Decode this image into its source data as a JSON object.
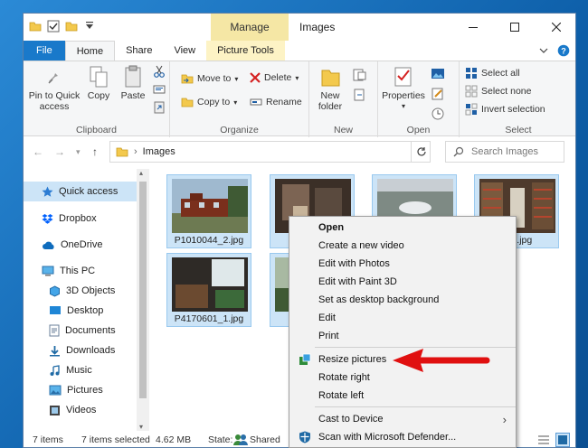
{
  "window": {
    "title": "Images",
    "context_tab": "Manage",
    "context_tab_group": "Picture Tools"
  },
  "ribbon": {
    "tabs": [
      "File",
      "Home",
      "Share",
      "View",
      "Picture Tools"
    ],
    "clipboard": {
      "pin": "Pin to Quick access",
      "copy": "Copy",
      "paste": "Paste",
      "label": "Clipboard"
    },
    "organize": {
      "move_to": "Move to",
      "copy_to": "Copy to",
      "delete": "Delete",
      "rename": "Rename",
      "label": "Organize"
    },
    "new": {
      "new_folder": "New folder",
      "label": "New"
    },
    "open": {
      "properties": "Properties",
      "label": "Open"
    },
    "select": {
      "select_all": "Select all",
      "select_none": "Select none",
      "invert": "Invert selection",
      "label": "Select"
    }
  },
  "address": {
    "path": "Images",
    "search_placeholder": "Search Images"
  },
  "navpane": {
    "items": [
      {
        "label": "Quick access",
        "icon": "star-icon"
      },
      {
        "label": "Dropbox",
        "icon": "dropbox-icon"
      },
      {
        "label": "OneDrive",
        "icon": "cloud-icon"
      },
      {
        "label": "This PC",
        "icon": "computer-icon"
      },
      {
        "label": "3D Objects",
        "icon": "cube-icon"
      },
      {
        "label": "Desktop",
        "icon": "desktop-icon"
      },
      {
        "label": "Documents",
        "icon": "document-icon"
      },
      {
        "label": "Downloads",
        "icon": "download-icon"
      },
      {
        "label": "Music",
        "icon": "music-icon"
      },
      {
        "label": "Pictures",
        "icon": "pictures-icon"
      },
      {
        "label": "Videos",
        "icon": "video-icon"
      }
    ]
  },
  "files": [
    {
      "name": "P1010044_2.jpg"
    },
    {
      "name": "P1"
    },
    {
      "name": ""
    },
    {
      "name": "8_1.jpg"
    },
    {
      "name": "P4170601_1.jpg"
    },
    {
      "name": "P4"
    }
  ],
  "context_menu": {
    "items": [
      {
        "label": "Open",
        "bold": true
      },
      {
        "label": "Create a new video"
      },
      {
        "label": "Edit with Photos"
      },
      {
        "label": "Edit with Paint 3D"
      },
      {
        "label": "Set as desktop background"
      },
      {
        "label": "Edit"
      },
      {
        "label": "Print"
      },
      {
        "label": "Resize pictures",
        "icon": "resize-icon"
      },
      {
        "label": "Rotate right"
      },
      {
        "label": "Rotate left"
      },
      {
        "label": "Cast to Device",
        "submenu": true
      },
      {
        "label": "Scan with Microsoft Defender...",
        "icon": "defender-icon"
      }
    ]
  },
  "status": {
    "count": "7 items",
    "selected": "7 items selected",
    "size": "4.62 MB",
    "state_label": "State:",
    "state_value": "Shared"
  },
  "colors": {
    "accent": "#1979ca",
    "manage_tab": "#f5e7a5",
    "selection": "#cce4f7",
    "arrow": "#e01010"
  }
}
